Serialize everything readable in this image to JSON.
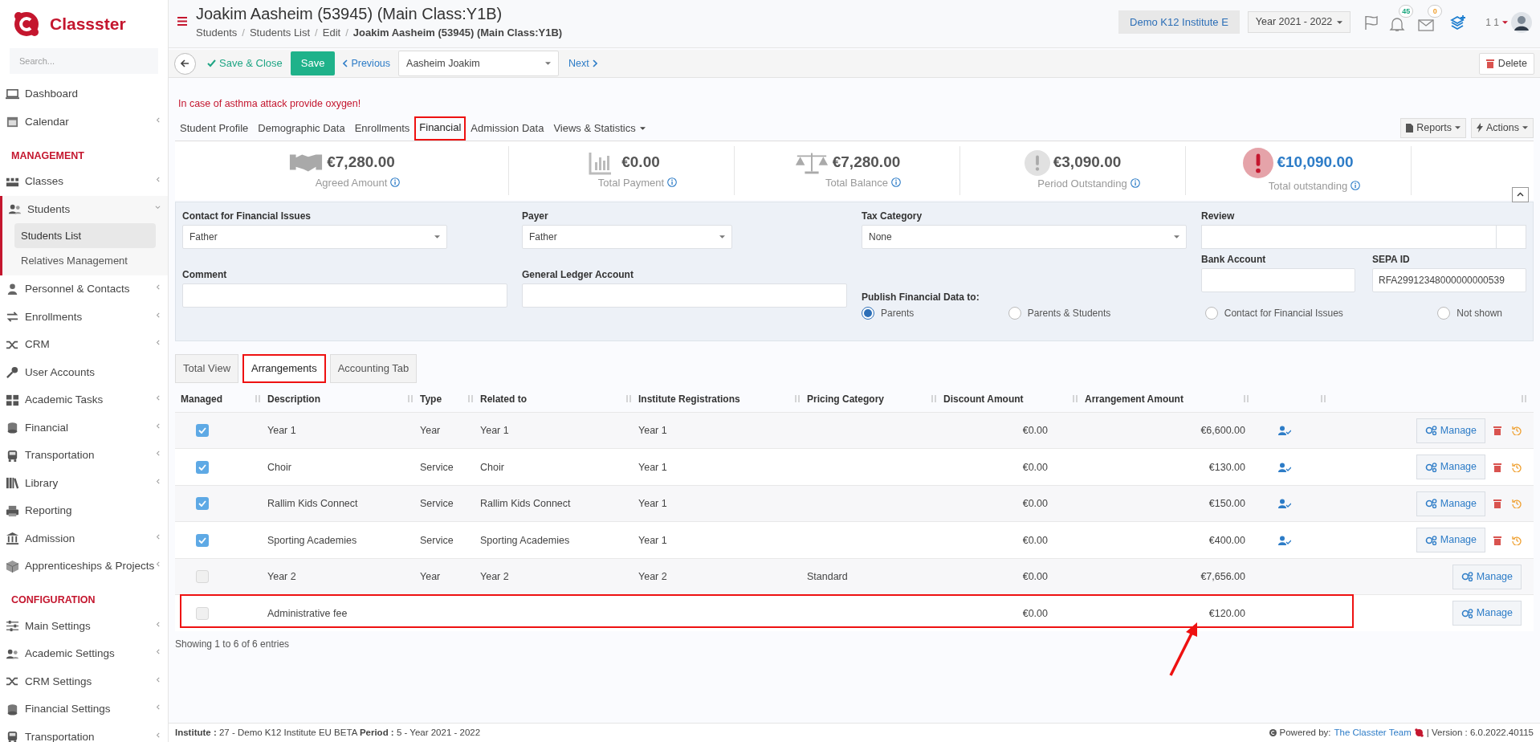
{
  "sidebar": {
    "logo": "Classster",
    "search_placeholder": "Search...",
    "items": [
      {
        "kind": "link",
        "label": "Dashboard",
        "submenu": false,
        "expanded": false
      },
      {
        "kind": "link",
        "label": "Calendar",
        "submenu": true,
        "expanded": false
      },
      {
        "kind": "header",
        "label": "MANAGEMENT"
      },
      {
        "kind": "link",
        "label": "Classes",
        "submenu": true,
        "expanded": false
      },
      {
        "kind": "link",
        "label": "Students",
        "submenu": true,
        "expanded": true,
        "children": [
          {
            "label": "Students List",
            "selected": true
          },
          {
            "label": "Relatives Management",
            "selected": false
          }
        ]
      },
      {
        "kind": "link",
        "label": "Personnel & Contacts",
        "submenu": true,
        "expanded": false
      },
      {
        "kind": "link",
        "label": "Enrollments",
        "submenu": true,
        "expanded": false
      },
      {
        "kind": "link",
        "label": "CRM",
        "submenu": true,
        "expanded": false
      },
      {
        "kind": "link",
        "label": "User Accounts",
        "submenu": false,
        "expanded": false
      },
      {
        "kind": "link",
        "label": "Academic Tasks",
        "submenu": true,
        "expanded": false
      },
      {
        "kind": "link",
        "label": "Financial",
        "submenu": true,
        "expanded": false
      },
      {
        "kind": "link",
        "label": "Transportation",
        "submenu": true,
        "expanded": false
      },
      {
        "kind": "link",
        "label": "Library",
        "submenu": true,
        "expanded": false
      },
      {
        "kind": "link",
        "label": "Reporting",
        "submenu": false,
        "expanded": false
      },
      {
        "kind": "link",
        "label": "Admission",
        "submenu": true,
        "expanded": false
      },
      {
        "kind": "link",
        "label": "Apprenticeships & Projects",
        "submenu": true,
        "expanded": false
      },
      {
        "kind": "header",
        "label": "CONFIGURATION"
      },
      {
        "kind": "link",
        "label": "Main Settings",
        "submenu": true,
        "expanded": false
      },
      {
        "kind": "link",
        "label": "Academic Settings",
        "submenu": true,
        "expanded": false
      },
      {
        "kind": "link",
        "label": "CRM Settings",
        "submenu": true,
        "expanded": false
      },
      {
        "kind": "link",
        "label": "Financial Settings",
        "submenu": true,
        "expanded": false
      },
      {
        "kind": "link",
        "label": "Transportation",
        "submenu": true,
        "expanded": false
      }
    ]
  },
  "header": {
    "title": "Joakim Aasheim (53945) (Main Class:Y1B)",
    "breadcrumb_separator": "/",
    "breadcrumbs": [
      "Students",
      "Students List",
      "Edit",
      "Joakim Aasheim (53945) (Main Class:Y1B)"
    ],
    "institute": "Demo K12 Institute E",
    "year": "Year 2021 - 2022",
    "notifications": "45",
    "messages": "0",
    "user": "1 1"
  },
  "toolbar": {
    "save_close": "Save & Close",
    "save": "Save",
    "previous": "Previous",
    "student": "Aasheim Joakim",
    "next": "Next",
    "delete": "Delete"
  },
  "alert": "In case of asthma attack provide oxygen!",
  "tabs": [
    {
      "label": "Student Profile",
      "selected": false,
      "annotated": false,
      "dropdown": false
    },
    {
      "label": "Demographic Data",
      "selected": false,
      "annotated": false,
      "dropdown": false
    },
    {
      "label": "Enrollments",
      "selected": false,
      "annotated": false,
      "dropdown": false
    },
    {
      "label": "Financial",
      "selected": true,
      "annotated": true,
      "dropdown": false
    },
    {
      "label": "Admission Data",
      "selected": false,
      "annotated": false,
      "dropdown": false
    },
    {
      "label": "Views & Statistics",
      "selected": false,
      "annotated": false,
      "dropdown": true
    }
  ],
  "tab_actions": [
    "Reports",
    "Actions"
  ],
  "summary": [
    {
      "kind": "agreed",
      "amount": "€7,280.00",
      "label": "Agreed Amount"
    },
    {
      "kind": "payment",
      "amount": "€0.00",
      "label": "Total Payment"
    },
    {
      "kind": "balance",
      "amount": "€7,280.00",
      "label": "Total Balance"
    },
    {
      "kind": "period",
      "amount": "€3,090.00",
      "label": "Period Outstanding"
    },
    {
      "kind": "total",
      "amount": "€10,090.00",
      "label": "Total outstanding"
    }
  ],
  "form": {
    "contact": {
      "label": "Contact for Financial Issues",
      "value": "Father"
    },
    "payer": {
      "label": "Payer",
      "value": "Father"
    },
    "tax": {
      "label": "Tax Category",
      "value": "None"
    },
    "review": {
      "label": "Review"
    },
    "bank": {
      "label": "Bank Account"
    },
    "sepa": {
      "label": "SEPA ID",
      "value": "RFA29912348000000000539"
    },
    "comment": {
      "label": "Comment"
    },
    "ledger": {
      "label": "General Ledger Account"
    },
    "publish": {
      "label": "Publish Financial Data to:",
      "options": [
        {
          "label": "Parents",
          "selected": true
        },
        {
          "label": "Parents & Students",
          "selected": false
        },
        {
          "label": "Contact for Financial Issues",
          "selected": false
        },
        {
          "label": "Not shown",
          "selected": false
        }
      ]
    }
  },
  "subtabs": [
    {
      "label": "Total View",
      "selected": false,
      "annotated": false
    },
    {
      "label": "Arrangements",
      "selected": true,
      "annotated": true
    },
    {
      "label": "Accounting Tab",
      "selected": false,
      "annotated": false
    }
  ],
  "table": {
    "columns": [
      "Managed",
      "Description",
      "Type",
      "Related to",
      "Institute Registrations",
      "Pricing Category",
      "Discount Amount",
      "Arrangement Amount"
    ],
    "rows": [
      {
        "managed": true,
        "description": "Year 1",
        "type": "Year",
        "related_to": "Year 1",
        "registration": "Year 1",
        "discount": "€0.00",
        "amount": "€6,600.00",
        "assigned": true,
        "removable": true,
        "annotated": false,
        "manage": "Manage"
      },
      {
        "managed": true,
        "description": "Choir",
        "type": "Service",
        "related_to": "Choir",
        "registration": "Year 1",
        "discount": "€0.00",
        "amount": "€130.00",
        "assigned": true,
        "removable": true,
        "annotated": false,
        "manage": "Manage"
      },
      {
        "managed": true,
        "description": "Rallim Kids Connect",
        "type": "Service",
        "related_to": "Rallim Kids Connect",
        "registration": "Year 1",
        "discount": "€0.00",
        "amount": "€150.00",
        "assigned": true,
        "removable": true,
        "annotated": false,
        "manage": "Manage"
      },
      {
        "managed": true,
        "description": "Sporting Academies",
        "type": "Service",
        "related_to": "Sporting Academies",
        "registration": "Year 1",
        "discount": "€0.00",
        "amount": "€400.00",
        "assigned": true,
        "removable": true,
        "annotated": false,
        "manage": "Manage"
      },
      {
        "managed": false,
        "description": "Year 2",
        "type": "Year",
        "related_to": "Year 2",
        "registration": "Year 2",
        "pricing": "Standard",
        "discount": "€0.00",
        "amount": "€7,656.00",
        "assigned": false,
        "removable": false,
        "annotated": false,
        "manage": "Manage"
      },
      {
        "managed": false,
        "description": "Administrative fee",
        "discount": "€0.00",
        "amount": "€120.00",
        "assigned": false,
        "removable": false,
        "annotated": true,
        "manage": "Manage"
      }
    ],
    "info": "Showing 1 to 6 of 6 entries"
  },
  "footer": {
    "info": "**Institute :** 27 - Demo K12 Institute EU BETA **Period :** 5 - Year 2021 - 2022",
    "powered": "Powered by:",
    "team": "The Classter Team",
    "version": "| Version : 6.0.2022.40115"
  }
}
